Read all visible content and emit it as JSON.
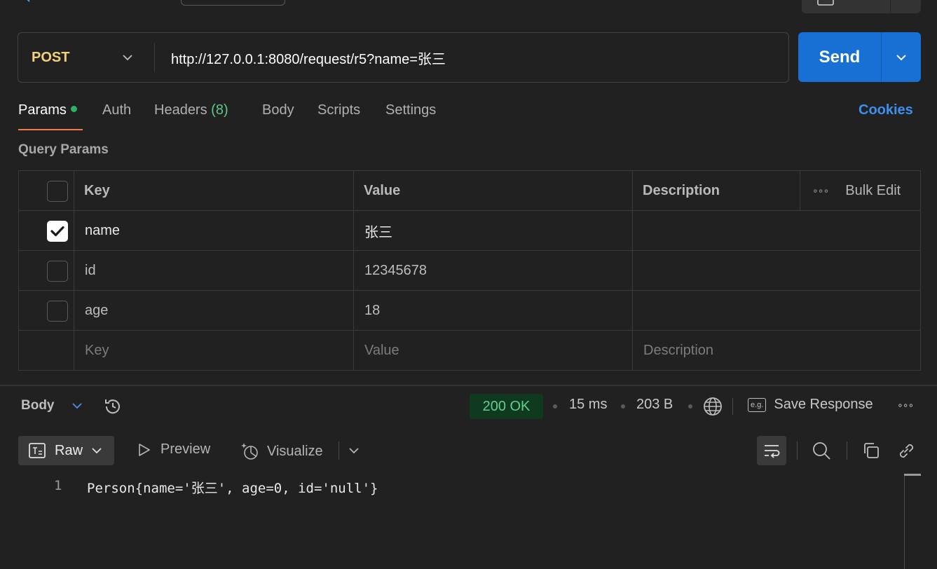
{
  "request": {
    "method": "POST",
    "url": "http://127.0.0.1:8080/request/r5?name=张三",
    "send_label": "Send"
  },
  "tabs": [
    {
      "label": "Params"
    },
    {
      "label": "Auth"
    },
    {
      "label": "Headers",
      "count": "(8)"
    },
    {
      "label": "Body"
    },
    {
      "label": "Scripts"
    },
    {
      "label": "Settings"
    }
  ],
  "cookies_label": "Cookies",
  "query_params": {
    "title": "Query Params",
    "columns": {
      "key": "Key",
      "value": "Value",
      "description": "Description"
    },
    "bulk_edit": "Bulk Edit",
    "more": "∘∘∘",
    "rows": [
      {
        "checked": true,
        "key": "name",
        "value": "张三"
      },
      {
        "checked": false,
        "key": "id",
        "value": "12345678"
      },
      {
        "checked": false,
        "key": "age",
        "value": "18"
      }
    ],
    "placeholder": {
      "key": "Key",
      "value": "Value",
      "description": "Description"
    }
  },
  "response": {
    "body_label": "Body",
    "status": "200 OK",
    "time": "15 ms",
    "size": "203 B",
    "save_label": "Save Response",
    "eg_label": "e.g.",
    "more": "∘∘∘",
    "formats": {
      "raw": "Raw",
      "preview": "Preview",
      "visualize": "Visualize"
    },
    "line_no": "1",
    "body_text": "Person{name='张三', age=0, id='null'}"
  },
  "colors": {
    "accent_blue": "#1870d5",
    "method_post": "#f3d07a",
    "status_ok": "#5ed08f",
    "active_tab_underline": "#f37a4a"
  }
}
